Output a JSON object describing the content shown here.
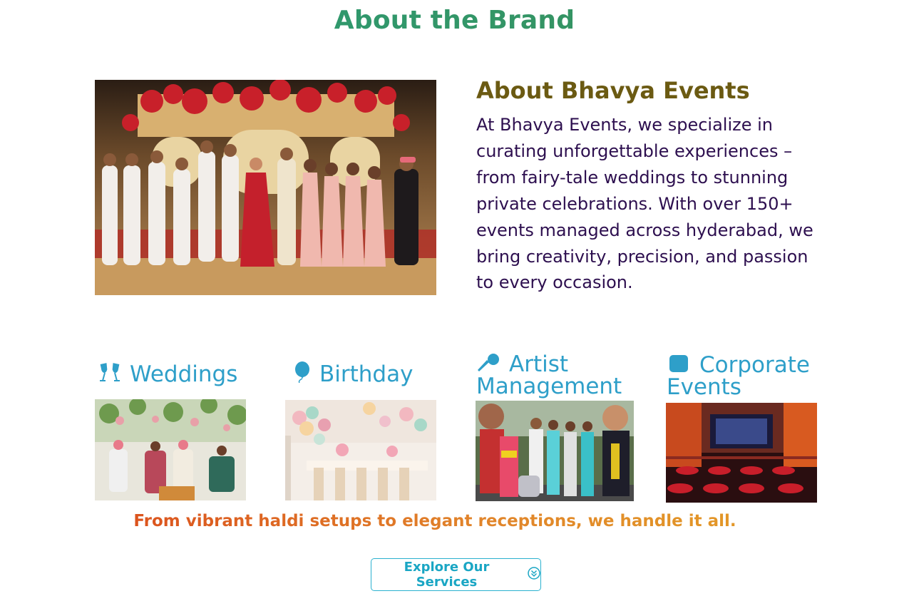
{
  "section": {
    "title": "About the Brand"
  },
  "about": {
    "heading": "About Bhavya Events",
    "text": "At Bhavya Events, we specialize in curating unforgettable experiences – from fairy-tale weddings to stunning private celebrations. With over 150+ events managed across hyderabad, we bring creativity, precision, and passion to every occasion."
  },
  "services": [
    {
      "label": "Weddings",
      "icon": "champagne-glasses-icon"
    },
    {
      "label": "Birthday",
      "icon": "balloon-icon"
    },
    {
      "label": "Artist Management",
      "icon": "microphone-icon"
    },
    {
      "label": "Corporate Events",
      "icon": "briefcase-icon"
    }
  ],
  "tagline": "From vibrant haldi setups to elegant receptions, we handle it all.",
  "cta": {
    "label": "Explore Our Services",
    "icon": "chevron-double-down-circle-icon"
  },
  "colors": {
    "title_gradient": [
      "#2a9d7a",
      "#3a8f56"
    ],
    "about_heading": "#6b5a12",
    "about_text": "#2d0f4f",
    "service_title": "#2e9fc9",
    "tagline_gradient": [
      "#d94119",
      "#e4a126"
    ],
    "button": "#1aa6c4"
  }
}
